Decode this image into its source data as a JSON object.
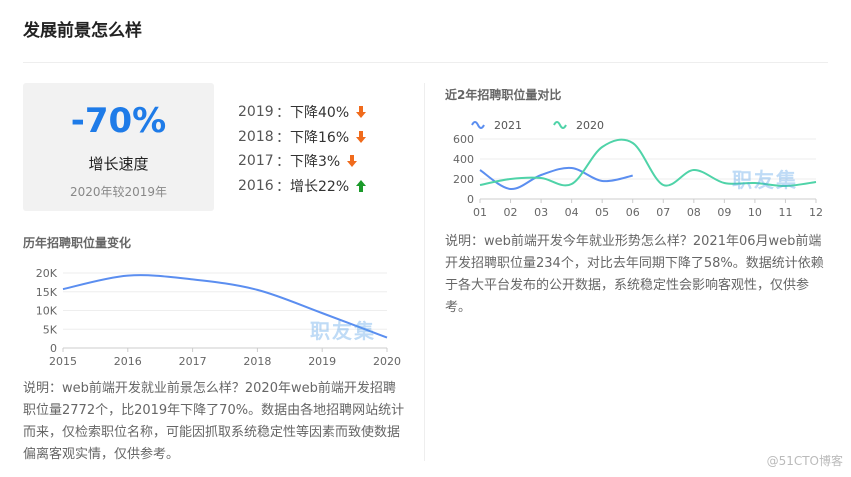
{
  "page": {
    "title": "发展前景怎么样"
  },
  "stat": {
    "value": "-70%",
    "label": "增长速度",
    "sub": "2020年较2019年"
  },
  "yoy": [
    {
      "year": "2019",
      "text": "下降40%",
      "dir": "down"
    },
    {
      "year": "2018",
      "text": "下降16%",
      "dir": "down"
    },
    {
      "year": "2017",
      "text": "下降3%",
      "dir": "down"
    },
    {
      "year": "2016",
      "text": "增长22%",
      "dir": "up"
    }
  ],
  "yoy_sep": "：",
  "colors": {
    "accent": "#1e7be8",
    "down": "#f06b1c",
    "up": "#1b9a2a",
    "series2021": "#5b8ef0",
    "series2020": "#4fd3a8"
  },
  "left_section": {
    "title": "历年招聘职位量变化",
    "watermark": "职友集",
    "desc": "说明：web前端开发就业前景怎么样？2020年web前端开发招聘职位量2772个，比2019年下降了70%。数据由各地招聘网站统计而来，仅检索职位名称，可能因抓取系统稳定性等因素而致使数据偏离客观实情，仅供参考。"
  },
  "right_section": {
    "title": "近2年招聘职位量对比",
    "watermark": "职友集",
    "desc": "说明：web前端开发今年就业形势怎么样？2021年06月web前端开发招聘职位量234个，对比去年同期下降了58%。数据统计依赖于各大平台发布的公开数据，系统稳定性会影响客观性，仅供参考。"
  },
  "credit": "@51CTO博客",
  "chart_data": [
    {
      "type": "line",
      "smooth": true,
      "x": [
        "2015",
        "2016",
        "2017",
        "2018",
        "2019",
        "2020"
      ],
      "series": [
        {
          "values": [
            15700,
            19300,
            18300,
            15500,
            9300,
            2772
          ]
        }
      ],
      "yticks": [
        "0",
        "5K",
        "10K",
        "15K",
        "20K"
      ],
      "ylim": [
        0,
        20000
      ],
      "grid": true
    },
    {
      "type": "line",
      "smooth": true,
      "x": [
        "01",
        "02",
        "03",
        "04",
        "05",
        "06",
        "07",
        "08",
        "09",
        "10",
        "11",
        "12"
      ],
      "series": [
        {
          "name": "2021",
          "values": [
            290,
            100,
            240,
            310,
            180,
            234
          ]
        },
        {
          "name": "2020",
          "values": [
            140,
            200,
            210,
            150,
            520,
            560,
            140,
            290,
            160,
            160,
            130,
            170
          ]
        }
      ],
      "yticks": [
        "0",
        "200",
        "400",
        "600"
      ],
      "ylim": [
        0,
        600
      ],
      "legend": "top-left",
      "grid": true
    }
  ]
}
